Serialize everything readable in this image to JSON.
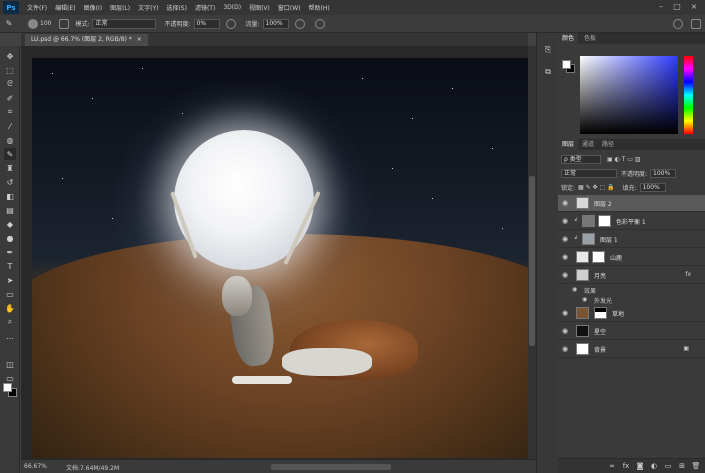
{
  "app": {
    "logo": "Ps"
  },
  "menu": [
    "文件(F)",
    "编辑(E)",
    "图像(I)",
    "图层(L)",
    "文字(Y)",
    "选择(S)",
    "滤镜(T)",
    "3D(D)",
    "视图(V)",
    "窗口(W)",
    "帮助(H)"
  ],
  "options": {
    "brush_size": "100",
    "mode_label": "模式:",
    "mode_value": "正常",
    "opacity_label": "不透明度:",
    "opacity_value": "0%",
    "flow_label": "流量:",
    "flow_value": "100%"
  },
  "document": {
    "tab_title": "LU.psd @ 66.7% (图层 2, RGB/8) *"
  },
  "status": {
    "zoom": "66.67%",
    "doc_info": "文档:7.64M/49.2M"
  },
  "color_panel": {
    "tabs": [
      "颜色",
      "色板"
    ]
  },
  "layers_panel": {
    "tabs": [
      "图层",
      "通道",
      "路径"
    ],
    "filter_label": "ρ 类型",
    "blend_mode": "正常",
    "opacity_label": "不透明度:",
    "opacity_value": "100%",
    "lock_label": "锁定:",
    "fill_label": "填充:",
    "fill_value": "100%",
    "layers": [
      {
        "name": "图层 2",
        "selected": true,
        "thumb_color": "#d8d8d8"
      },
      {
        "name": "色彩平衡 1",
        "selected": false,
        "thumb_color": "#ffffff"
      },
      {
        "name": "图层 1",
        "selected": false,
        "thumb_color": "#9aa0a8"
      },
      {
        "name": "山鹿",
        "selected": false,
        "thumb_color": "#e8e8e8"
      },
      {
        "name": "月亮",
        "selected": false,
        "thumb_color": "#cfcfcf",
        "fx": "fx"
      },
      {
        "name": "草地",
        "selected": false,
        "thumb_color": "#7a5432"
      },
      {
        "name": "星空",
        "selected": false,
        "thumb_color": "#111111"
      },
      {
        "name": "背景",
        "selected": false,
        "thumb_color": "#ffffff"
      }
    ],
    "effects_label": "效果",
    "outer_glow_label": "外发光"
  }
}
